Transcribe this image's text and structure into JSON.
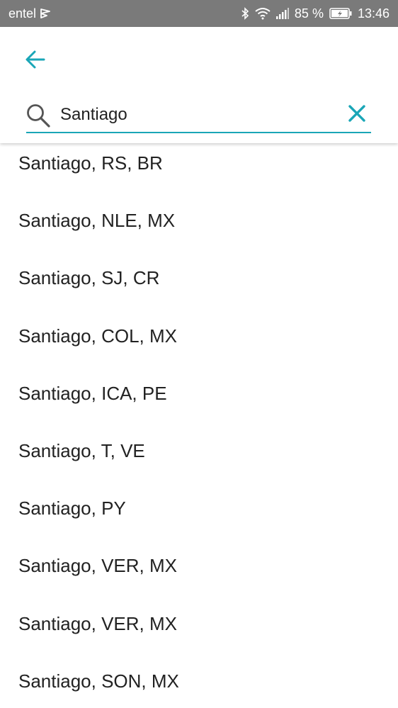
{
  "status_bar": {
    "carrier": "entel",
    "battery_percent": "85 %",
    "time": "13:46",
    "icons": [
      "carrier-flag-icon",
      "bluetooth-icon",
      "wifi-icon",
      "signal-icon",
      "battery-icon"
    ]
  },
  "header": {
    "back_icon": "arrow-left-icon",
    "accent_color": "#1aa6b7"
  },
  "search": {
    "value": "Santiago",
    "icon": "search-icon",
    "clear_icon": "close-icon"
  },
  "results": [
    {
      "label": "Santiago, RS, BR"
    },
    {
      "label": "Santiago, NLE, MX"
    },
    {
      "label": "Santiago, SJ, CR"
    },
    {
      "label": "Santiago, COL, MX"
    },
    {
      "label": "Santiago, ICA, PE"
    },
    {
      "label": "Santiago, T, VE"
    },
    {
      "label": "Santiago, PY"
    },
    {
      "label": "Santiago, VER, MX"
    },
    {
      "label": "Santiago, VER, MX"
    },
    {
      "label": "Santiago, SON, MX"
    }
  ]
}
